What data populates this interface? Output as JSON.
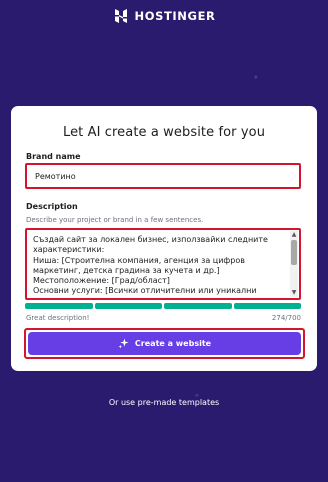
{
  "brand": {
    "name": "HOSTINGER",
    "logo_icon": "hostinger-logo-icon"
  },
  "card": {
    "title": "Let AI create a website for you",
    "brand_name_label": "Brand name",
    "brand_name_value": "Ремотино",
    "description_label": "Description",
    "description_helper": "Describe your project or brand in a few sentences.",
    "description_value": "Създай сайт за локален бизнес, използвайки следните характеристики:\nНиша: [Строителна компания, агенция за цифров маркетинг, детска градина за кучета и др.]\nМестоположение: [Град/област]\nОсновни услуги: [Всички отличителни или уникални услуги,",
    "scroll_up_glyph": "▲",
    "scroll_down_glyph": "▼",
    "progress": {
      "filled_segments": 4,
      "total_segments": 4,
      "color": "#00b090"
    },
    "quality_hint": "Great description!",
    "char_count": "274/700",
    "create_button_label": "Create a website",
    "create_button_icon": "sparkle-icon"
  },
  "templates_link": "Or use pre-made templates",
  "colors": {
    "background": "#2a1b6e",
    "accent": "#673de6",
    "highlight_border": "#d4162c"
  }
}
